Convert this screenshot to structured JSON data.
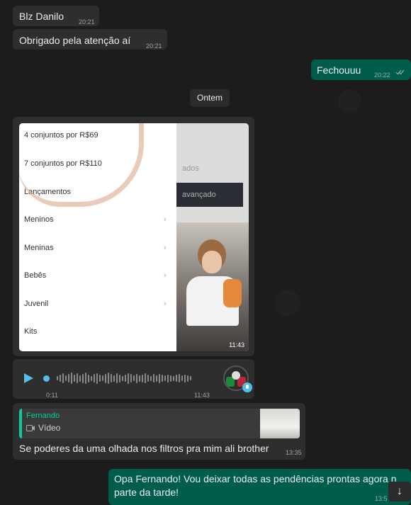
{
  "messages": {
    "m1": {
      "text": "Blz Danilo",
      "time": "20:21"
    },
    "m2": {
      "text": "Obrigado pela atenção aí",
      "time": "20:21"
    },
    "m3": {
      "text": "Fechouuu",
      "time": "20:22"
    },
    "date_separator": "Ontem",
    "image_msg": {
      "time": "11:43",
      "menu_items": [
        "4 conjuntos por R$69",
        "7 conjuntos por R$110",
        "Lançamentos",
        "Meninos",
        "Meninas",
        "Bebês",
        "Juvenil",
        "Kits"
      ],
      "right_text": "ados",
      "right_button": "avançado"
    },
    "audio_msg": {
      "elapsed": "0:11",
      "time": "11:43",
      "progress": 0.0
    },
    "reply_msg": {
      "quoted_author": "Fernando",
      "quoted_type": "Vídeo",
      "text": "Se poderes da uma olhada nos filtros pra mim ali brother",
      "time": "13:35"
    },
    "m_last": {
      "text": "Opa Fernando! Vou deixar todas as pendências prontas agora n parte da tarde!",
      "time": "13:5"
    }
  },
  "colors": {
    "outgoing": "#005c4b",
    "incoming": "#2e2e2e",
    "accent": "#06cf9c",
    "play": "#53bdeb"
  },
  "icons": {
    "read": "double-check-icon",
    "play": "play-icon",
    "mic": "mic-icon",
    "video": "video-icon",
    "scroll": "arrow-down-icon"
  }
}
